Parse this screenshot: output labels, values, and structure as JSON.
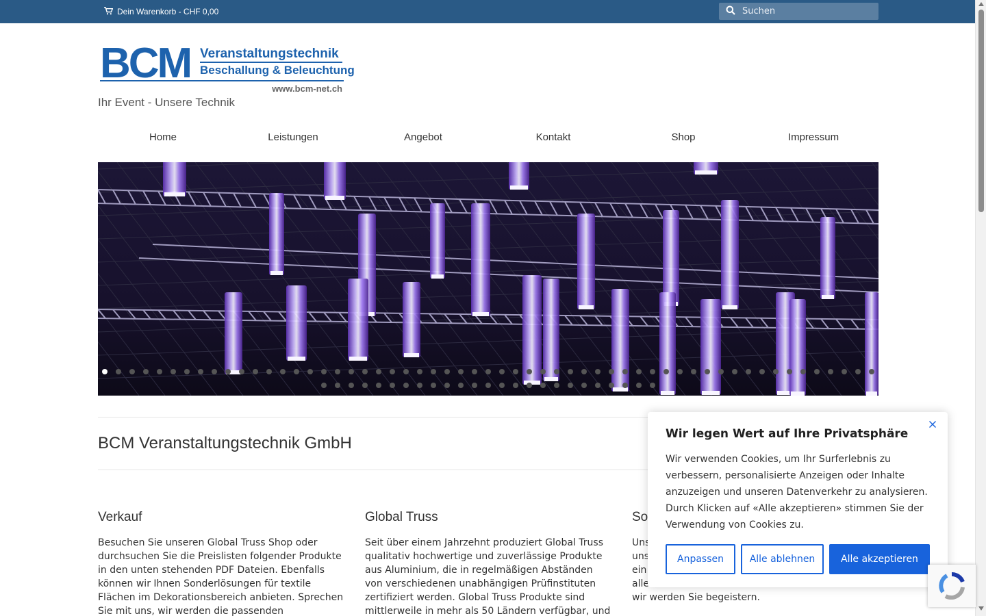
{
  "topbar": {
    "cart_label": "Dein Warenkorb - CHF 0,00",
    "search_placeholder": "Suchen"
  },
  "header": {
    "logo": {
      "bcm": "BCM",
      "line1": "Veranstaltungstechnik",
      "line2": "Beschallung & Beleuchtung",
      "url": "www.bcm-net.ch"
    },
    "tagline": "Ihr Event - Unsere Technik"
  },
  "nav": {
    "items": [
      {
        "label": "Home"
      },
      {
        "label": "Leistungen"
      },
      {
        "label": "Angebot"
      },
      {
        "label": "Kontakt"
      },
      {
        "label": "Shop"
      },
      {
        "label": "Impressum"
      }
    ]
  },
  "hero": {
    "accent_color": "#9b6dff",
    "slide_dots_row1": 57,
    "slide_dots_row2": 25
  },
  "main": {
    "title": "BCM Veranstaltungstechnik GmbH",
    "columns": [
      {
        "heading": "Verkauf",
        "text": "Besuchen Sie unseren Global Truss Shop oder durchsuchen Sie die Preislisten folgender Produkte in den unten stehenden PDF Dateien. Ebenfalls können wir Ihnen Sonderlösungen für textile Flächen im Dekorationsbereich anbieten. Sprechen Sie mit uns, wir werden die passenden"
      },
      {
        "heading": "Global Truss",
        "text": "Seit über einem Jahrzehnt produziert Global Truss qualitativ hochwertige und zuverlässige Produkte aus Aluminium, die in regelmäßigen Abständen von verschiedenen unabhängigen Prüfinstituten zertifiziert werden. Global Truss Produkte sind mittlerweile in mehr als 50 Ländern verfügbar, und"
      },
      {
        "heading": "Son",
        "text_lines": [
          "Uns",
          "uns",
          "ein",
          "alle",
          "wir werden Sie begeistern."
        ]
      }
    ]
  },
  "cookie": {
    "title": "Wir legen Wert auf Ihre Privatsphäre",
    "message": "Wir verwenden Cookies, um Ihr Surferlebnis zu verbessern, personalisierte Anzeigen oder Inhalte anzuzeigen und unseren Datenverkehr zu analysieren. Durch Klicken auf «Alle akzeptieren» stimmen Sie der Verwendung von Cookies zu.",
    "btn_customize": "Anpassen",
    "btn_reject": "Alle ablehnen",
    "btn_accept": "Alle akzeptieren",
    "accent": "#1863dc"
  },
  "colors": {
    "topbar": "#2a5a86",
    "brand_blue": "#1d62ad"
  }
}
